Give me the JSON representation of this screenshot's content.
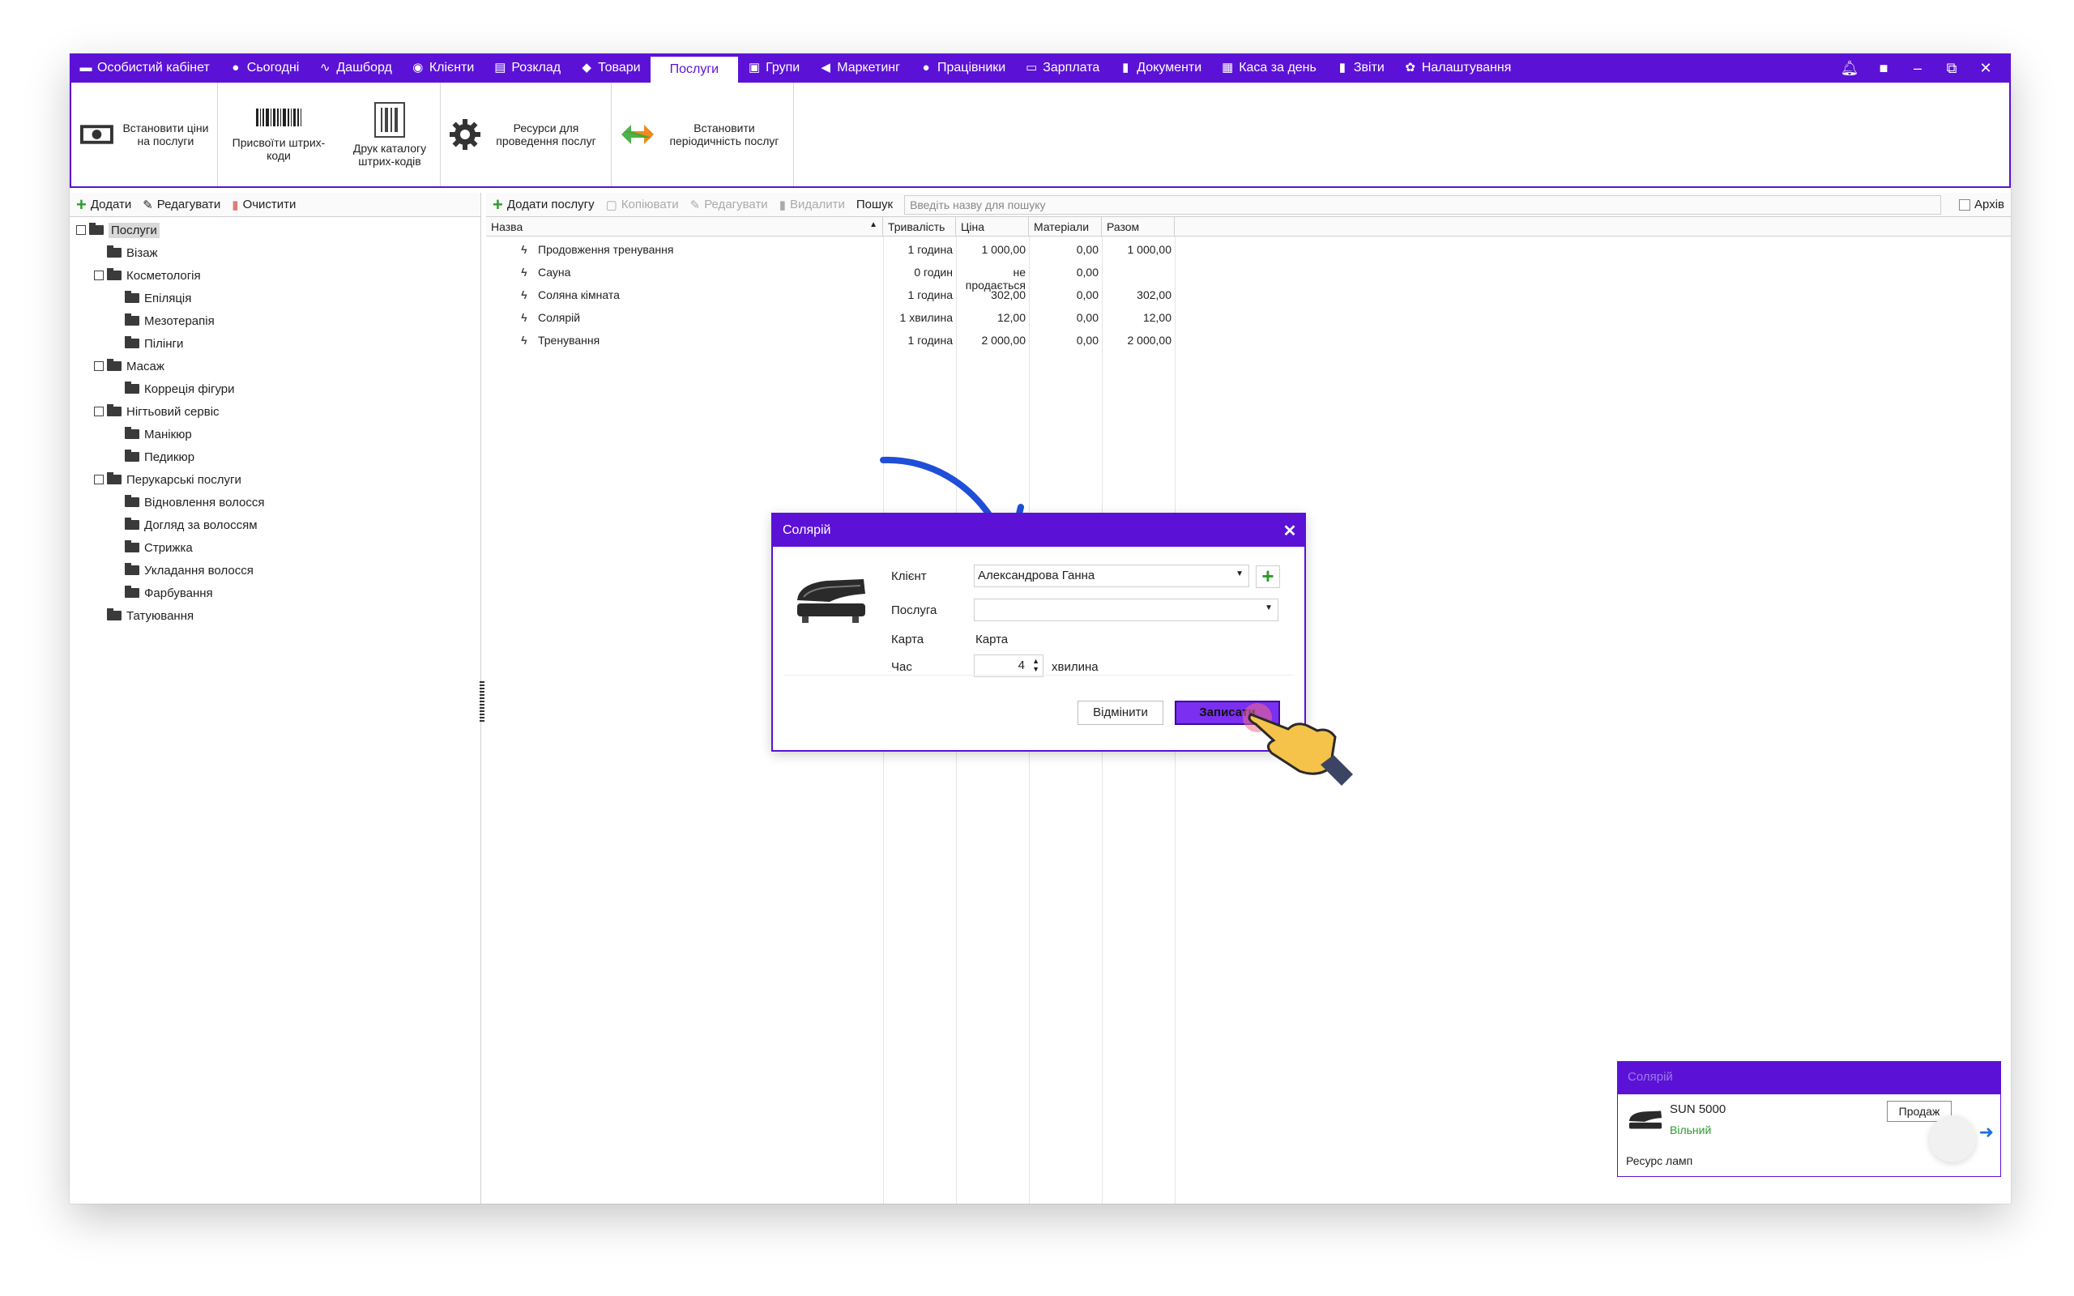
{
  "menubar": {
    "tabs": [
      {
        "label": "Особистий кабінет",
        "icon": "briefcase-icon"
      },
      {
        "label": "Сьогодні",
        "icon": "circle-icon"
      },
      {
        "label": "Дашборд",
        "icon": "pulse-icon"
      },
      {
        "label": "Клієнти",
        "icon": "user-circle-icon"
      },
      {
        "label": "Розклад",
        "icon": "calendar-icon"
      },
      {
        "label": "Товари",
        "icon": "box-icon"
      },
      {
        "label": "Послуги",
        "icon": "",
        "active": true
      },
      {
        "label": "Групи",
        "icon": "image-icon"
      },
      {
        "label": "Маркетинг",
        "icon": "megaphone-icon"
      },
      {
        "label": "Працівники",
        "icon": "person-icon"
      },
      {
        "label": "Зарплата",
        "icon": "money-icon"
      },
      {
        "label": "Документи",
        "icon": "document-icon"
      },
      {
        "label": "Каса за день",
        "icon": "calculator-icon"
      },
      {
        "label": "Звіти",
        "icon": "bar-chart-icon"
      },
      {
        "label": "Налаштування",
        "icon": "gear-icon"
      }
    ],
    "window_controls": [
      "bell-icon",
      "lock-icon",
      "minimize-icon",
      "restore-icon",
      "close-icon"
    ]
  },
  "ribbon": {
    "set_prices": "Встановити ціни на послуги",
    "assign_barcodes": "Присвоїти штрих-коди",
    "print_catalog": "Друк каталогу штрих-кодів",
    "resources": "Ресурси для проведення послуг",
    "periodicity": "Встановити періодичність послуг"
  },
  "left_toolbar": {
    "add": "Додати",
    "edit": "Редагувати",
    "clear": "Очистити"
  },
  "tree": [
    {
      "label": "Послуги",
      "level": 0,
      "expand": true,
      "selected": true
    },
    {
      "label": "Візаж",
      "level": 1
    },
    {
      "label": "Косметологія",
      "level": 1,
      "expand": true
    },
    {
      "label": "Епіляція",
      "level": 2
    },
    {
      "label": "Мезотерапія",
      "level": 2
    },
    {
      "label": "Пілінги",
      "level": 2
    },
    {
      "label": "Масаж",
      "level": 1,
      "expand": true
    },
    {
      "label": "Корреція фігури",
      "level": 2
    },
    {
      "label": "Нігтьовий сервіс",
      "level": 1,
      "expand": true
    },
    {
      "label": "Манікюр",
      "level": 2
    },
    {
      "label": "Педикюр",
      "level": 2
    },
    {
      "label": "Перукарські послуги",
      "level": 1,
      "expand": true
    },
    {
      "label": "Відновлення волосся",
      "level": 2
    },
    {
      "label": "Догляд за волоссям",
      "level": 2
    },
    {
      "label": "Стрижка",
      "level": 2
    },
    {
      "label": "Укладання волосся",
      "level": 2
    },
    {
      "label": "Фарбування",
      "level": 2
    },
    {
      "label": "Татуювання",
      "level": 1
    }
  ],
  "right_toolbar": {
    "add_service": "Додати послугу",
    "copy": "Копіювати",
    "edit": "Редагувати",
    "delete": "Видалити",
    "search_label": "Пошук",
    "search_placeholder": "Введіть назву для пошуку",
    "archive": "Архів"
  },
  "table": {
    "columns": [
      "Назва",
      "Тривалість",
      "Ціна",
      "Матеріали",
      "Разом"
    ],
    "rows": [
      {
        "name": "Продовження тренування",
        "duration": "1 година",
        "price": "1 000,00",
        "materials": "0,00",
        "total": "1 000,00"
      },
      {
        "name": "Сауна",
        "duration": "0 годин",
        "price": "не продається",
        "materials": "0,00",
        "total": ""
      },
      {
        "name": "Соляна кімната",
        "duration": "1 година",
        "price": "302,00",
        "materials": "0,00",
        "total": "302,00"
      },
      {
        "name": "Солярій",
        "duration": "1 хвилина",
        "price": "12,00",
        "materials": "0,00",
        "total": "12,00"
      },
      {
        "name": "Тренування",
        "duration": "1 година",
        "price": "2 000,00",
        "materials": "0,00",
        "total": "2 000,00"
      }
    ]
  },
  "dialog": {
    "title": "Солярій",
    "client_label": "Клієнт",
    "client_value": "Александрова Ганна",
    "service_label": "Послуга",
    "service_value": "",
    "card_label": "Карта",
    "card_value": "Карта",
    "time_label": "Час",
    "time_value": "4",
    "time_unit": "хвилина",
    "cancel": "Відмінити",
    "save": "Записати"
  },
  "widget": {
    "title": "Солярій",
    "device": "SUN 5000",
    "status": "Вільний",
    "sell": "Продаж",
    "lamp": "Ресурс ламп"
  },
  "colors": {
    "brand": "#5b12d6",
    "accent": "#7b2ff0",
    "status_free": "#2b9d2b"
  }
}
